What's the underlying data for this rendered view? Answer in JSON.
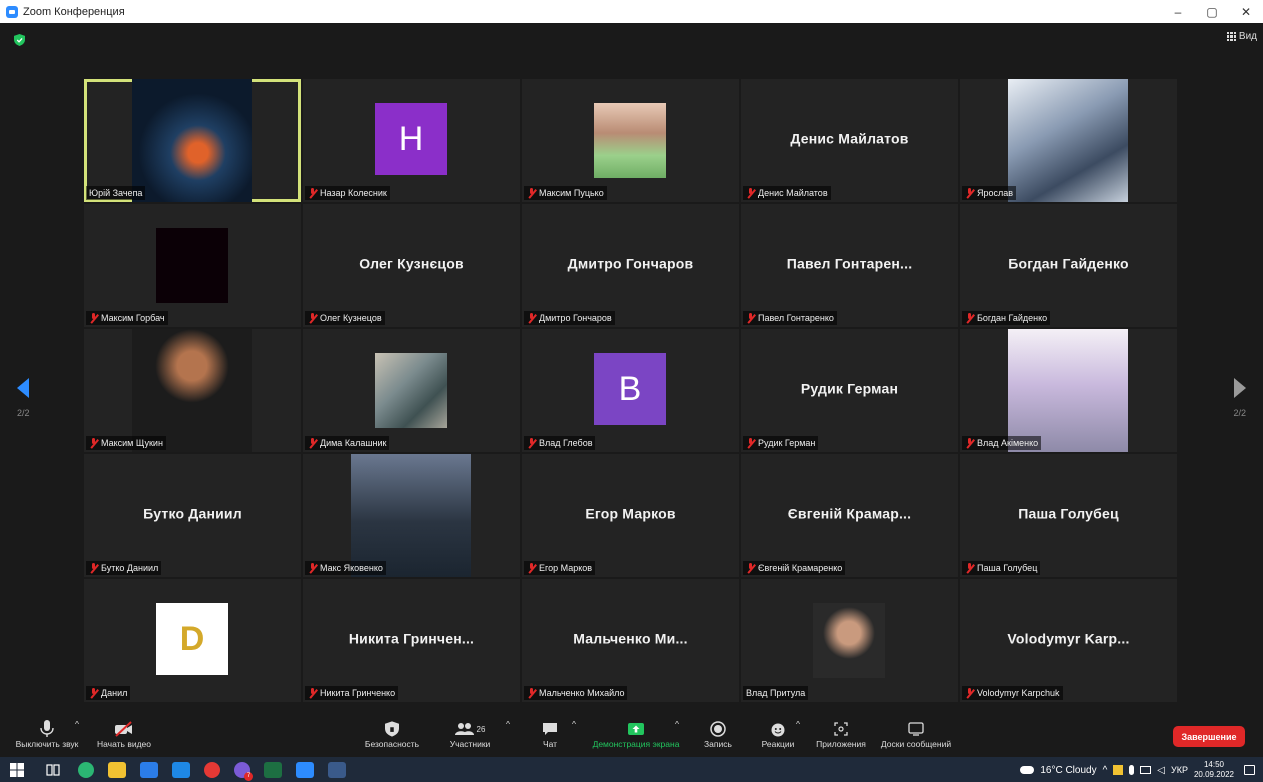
{
  "window": {
    "title": "Zoom Конференция",
    "controls": [
      "–",
      "▢",
      "✕"
    ]
  },
  "meeting": {
    "view_label": "Вид",
    "page_indicator_left": "2/2",
    "page_indicator_right": "2/2",
    "tiles": [
      {
        "label": "Юрій Зачепа",
        "muted": false,
        "kind": "image",
        "active": true
      },
      {
        "label": "Назар Колесник",
        "muted": true,
        "kind": "letter",
        "letter": "H",
        "color": "#8b2fc9"
      },
      {
        "label": "Максим Пуцько",
        "muted": true,
        "kind": "image"
      },
      {
        "label": "Денис Майлатов",
        "muted": true,
        "kind": "name",
        "display": "Денис Майлатов"
      },
      {
        "label": "Ярослав",
        "muted": true,
        "kind": "image"
      },
      {
        "label": "Максим Горбач",
        "muted": true,
        "kind": "image"
      },
      {
        "label": "Олег Кузнецов",
        "muted": true,
        "kind": "name",
        "display": "Олег Кузнєцов"
      },
      {
        "label": "Дмитро Гончаров",
        "muted": true,
        "kind": "name",
        "display": "Дмитро Гончаров"
      },
      {
        "label": "Павел Гонтаренко",
        "muted": true,
        "kind": "name",
        "display": "Павел  Гонтарен..."
      },
      {
        "label": "Богдан Гайденко",
        "muted": true,
        "kind": "name",
        "display": "Богдан Гайденко"
      },
      {
        "label": "Максим Щукин",
        "muted": true,
        "kind": "image"
      },
      {
        "label": "Дима Калашник",
        "muted": true,
        "kind": "image"
      },
      {
        "label": "Влад Глебов",
        "muted": true,
        "kind": "letter",
        "letter": "B",
        "color": "#7b45c4"
      },
      {
        "label": "Рудик Герман",
        "muted": true,
        "kind": "name",
        "display": "Рудик Герман"
      },
      {
        "label": "Влад Акіменко",
        "muted": true,
        "kind": "image"
      },
      {
        "label": "Бутко Даниил",
        "muted": true,
        "kind": "name",
        "display": "Бутко Даниил"
      },
      {
        "label": "Макс Яковенко",
        "muted": true,
        "kind": "image"
      },
      {
        "label": "Егор Марков",
        "muted": true,
        "kind": "name",
        "display": "Егор Марков"
      },
      {
        "label": "Євгеній Крамаренко",
        "muted": true,
        "kind": "name",
        "display": "Євгеній  Крамар..."
      },
      {
        "label": "Паша Голубец",
        "muted": true,
        "kind": "name",
        "display": "Паша Голубец"
      },
      {
        "label": "Данил",
        "muted": true,
        "kind": "letter",
        "letter": "D",
        "color": "#ffffff"
      },
      {
        "label": "Никита Гринченко",
        "muted": true,
        "kind": "name",
        "display": "Никита  Гринчен..."
      },
      {
        "label": "Мальченко Михайло",
        "muted": true,
        "kind": "name",
        "display": "Мальченко  Ми..."
      },
      {
        "label": "Влад Притула",
        "muted": false,
        "kind": "image"
      },
      {
        "label": "Volodymyr Karpchuk",
        "muted": true,
        "kind": "name",
        "display": "Volodymyr  Karp..."
      }
    ]
  },
  "toolbar": {
    "unmute": "Выключить звук",
    "start_video": "Начать видео",
    "security": "Безопасность",
    "participants": "Участники",
    "participants_count": "26",
    "chat": "Чат",
    "share_screen": "Демонстрация экрана",
    "record": "Запись",
    "reactions": "Реакции",
    "apps": "Приложения",
    "whiteboards": "Доски сообщений",
    "end": "Завершение"
  },
  "taskbar": {
    "weather": "16°C  Cloudy",
    "language": "УКР",
    "time": "14:50",
    "date": "20.09.2022",
    "badge": "7"
  }
}
